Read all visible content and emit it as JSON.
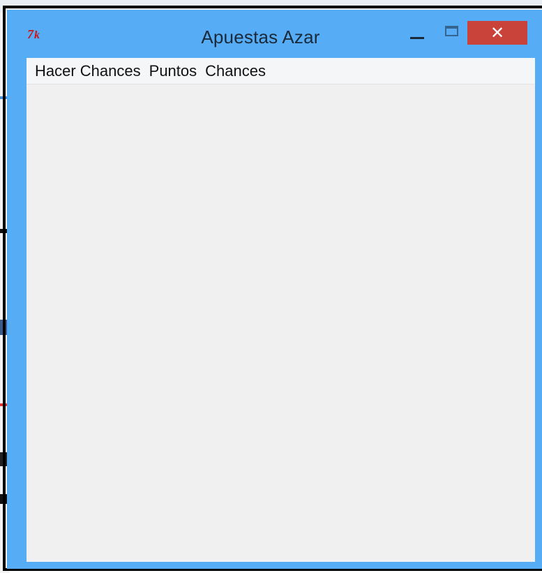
{
  "window": {
    "title": "Apuestas Azar",
    "close_glyph": "✕",
    "app_icon": "tk-feather-icon"
  },
  "menubar": {
    "items": [
      {
        "label": "Hacer Chances"
      },
      {
        "label": "Puntos"
      },
      {
        "label": "Chances"
      }
    ]
  },
  "colors": {
    "frame": "#56adf6",
    "close_button": "#c9433b",
    "client_bg": "#f0f0f0",
    "menubar_bg": "#f5f6f7"
  }
}
